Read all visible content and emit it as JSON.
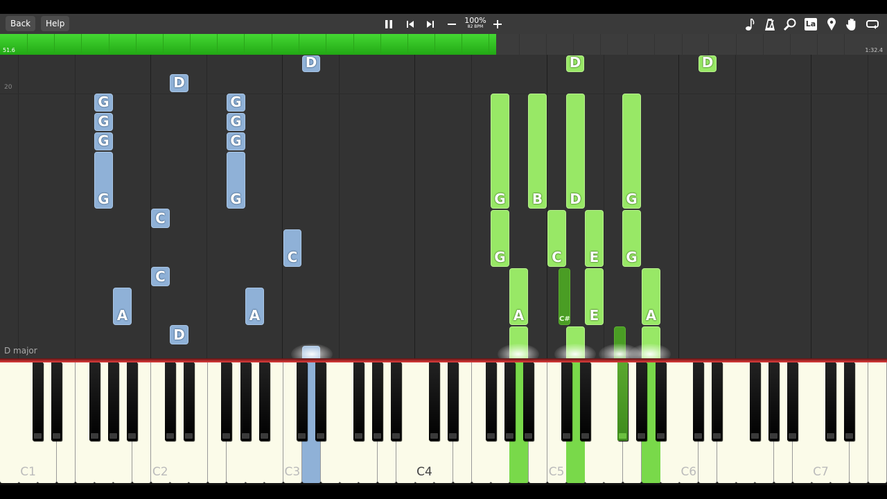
{
  "toolbar": {
    "back_label": "Back",
    "help_label": "Help",
    "zoom": "100%",
    "tempo": "82 BPM",
    "controls": [
      "pause-icon",
      "skip-back-icon",
      "skip-forward-icon",
      "minus-icon",
      "plus-icon"
    ],
    "right_tools": [
      {
        "name": "note-icon",
        "glyph": "♪"
      },
      {
        "name": "metronome-icon",
        "glyph": "▲"
      },
      {
        "name": "magnifier-icon",
        "glyph": "⌕"
      },
      {
        "name": "note-labels-icon",
        "glyph": "La"
      },
      {
        "name": "location-pin-icon",
        "glyph": "⬤"
      },
      {
        "name": "hand-icon",
        "glyph": "✋"
      },
      {
        "name": "loop-icon",
        "glyph": "⟲"
      }
    ]
  },
  "progress": {
    "current_time": "51.6",
    "total_time": "1:32.4",
    "fraction": 0.559,
    "fill_color": "#33c41f"
  },
  "roll": {
    "measure_number": "20",
    "key_signature": "D major",
    "notes_blue": [
      "D",
      "G",
      "G",
      "G",
      "G",
      "D",
      "G",
      "G",
      "G",
      "G",
      "C",
      "C",
      "C",
      "A",
      "A",
      "D"
    ],
    "notes_green": [
      "D",
      "D",
      "G",
      "B",
      "D",
      "G",
      "G",
      "C",
      "E",
      "G",
      "A",
      "E",
      "A"
    ],
    "notes_dark": [
      "C#"
    ]
  },
  "keyboard": {
    "octave_labels": [
      "C1",
      "C2",
      "C3",
      "C4",
      "C5",
      "C6",
      "C7"
    ],
    "accent_left": "#8fb1d7",
    "accent_right": "#98e866"
  }
}
